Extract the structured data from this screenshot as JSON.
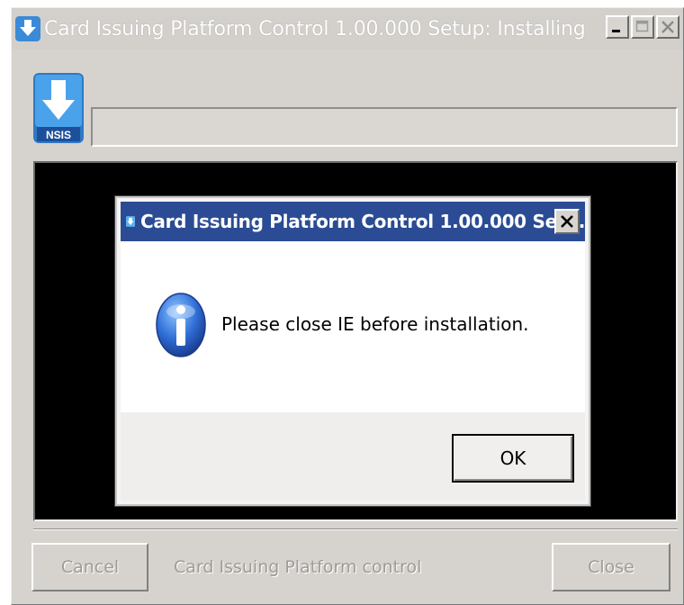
{
  "main_window": {
    "title": "Card Issuing Platform Control 1.00.000 Setup: Installing",
    "icon": "nsis-installer-icon",
    "controls": {
      "minimize": "minimize-icon",
      "maximize": "maximize-icon",
      "close": "close-icon"
    },
    "logo_text": "NSIS",
    "progress_fraction": 0,
    "status_text": "Card Issuing Platform control",
    "cancel_label": "Cancel",
    "close_label": "Close"
  },
  "message_box": {
    "title": "Card Issuing Platform Control 1.00.000 Set...",
    "icon": "info-icon",
    "message": "Please close IE before installation.",
    "ok_label": "OK"
  },
  "colors": {
    "titlebar_active": "#2b4c94",
    "window_face": "#d6d3ce",
    "log_background": "#000000"
  }
}
